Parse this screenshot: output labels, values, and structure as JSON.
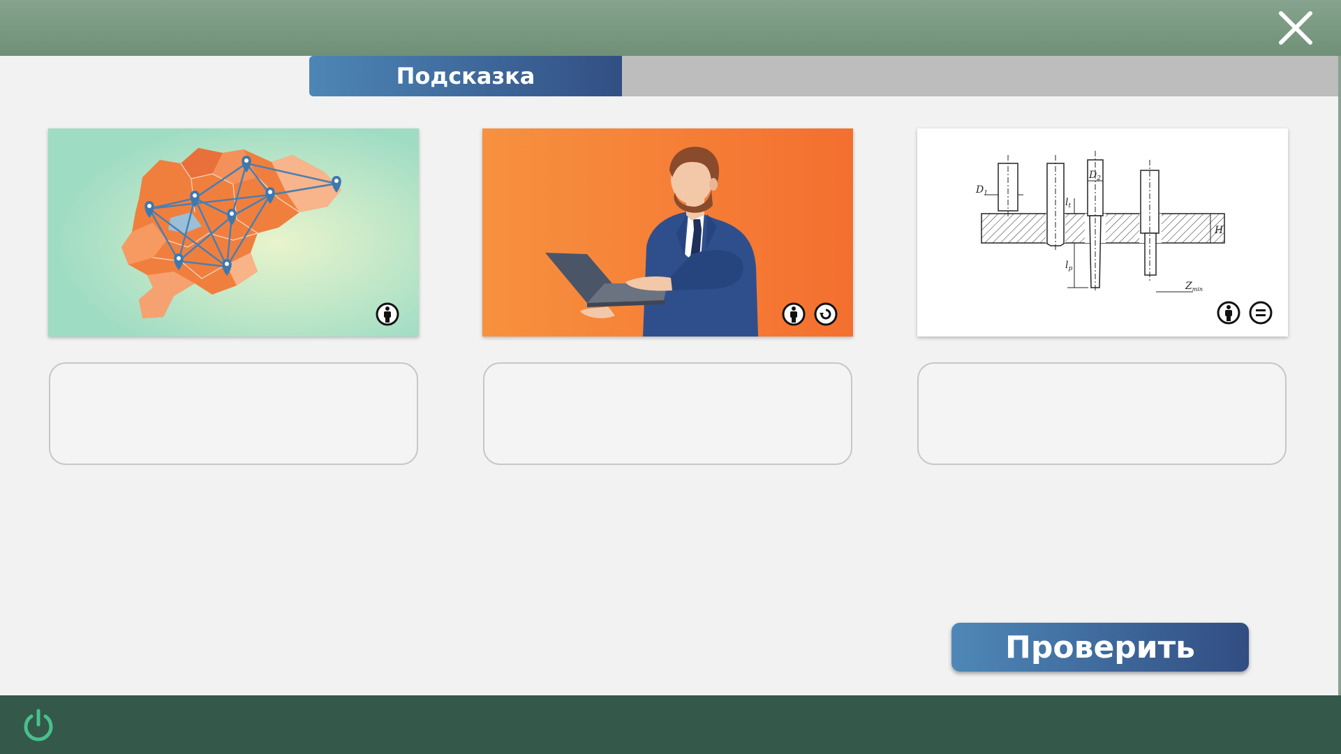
{
  "window": {
    "close_icon": "close-icon",
    "power_icon": "power-icon",
    "colors": {
      "top_bar": "#7a9a82",
      "bottom_bar": "#34584a",
      "accent_blue": "#3b6aa0",
      "power_icon": "#49c08c"
    }
  },
  "tabs": {
    "hint_label": "Подсказка"
  },
  "cards": [
    {
      "image": "map-with-network-pins",
      "license_icons": [
        "cc-by-icon"
      ],
      "answer_value": ""
    },
    {
      "image": "businessman-with-laptop",
      "license_icons": [
        "cc-by-icon",
        "cc-sa-icon"
      ],
      "answer_value": ""
    },
    {
      "image": "technical-drawing-holes",
      "license_icons": [
        "cc-by-icon",
        "cc-nd-icon"
      ],
      "answer_value": ""
    }
  ],
  "drawing_labels": {
    "d1": "D",
    "d1_sub": "1",
    "d2": "D",
    "d2_sub": "2",
    "lt": "l",
    "lt_sub": "t",
    "lp": "l",
    "lp_sub": "p",
    "h": "H",
    "z": "Z",
    "z_sub": "min"
  },
  "actions": {
    "check_label": "Проверить"
  }
}
